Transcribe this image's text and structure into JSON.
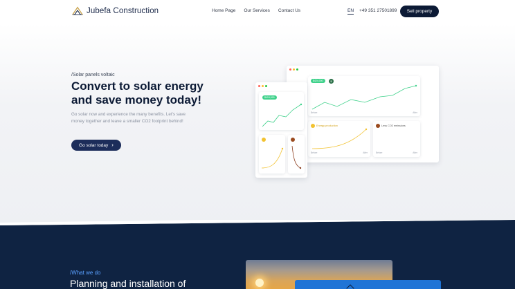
{
  "brand": {
    "name": "Jubefa Construction"
  },
  "nav": {
    "links": [
      "Home Page",
      "Our Services",
      "Contact Us"
    ],
    "language": "EN",
    "phone": "+49 351 27501899",
    "cta": "Sell property"
  },
  "hero": {
    "eyebrow": "/Solar panels voltaic",
    "headline": "Convert to solar energy and save money today!",
    "subtext": "Go solar now and experience the many benefits. Let's save money together and leave a smaller CO2 footprint behind!",
    "cta": "Go solar today"
  },
  "dashboard": {
    "savings_pill": "$424,000",
    "savings_pill_small": "$424,000",
    "energy_label": "Energy production",
    "co2_label": "Less CO2 emissions",
    "before_label": "Before",
    "after_label": "After"
  },
  "section": {
    "eyebrow": "/What we do",
    "title": "Planning and installation of"
  },
  "colors": {
    "navy": "#0c1a35",
    "cta_blue": "#1c2d5a",
    "green": "#3ed18a",
    "yellow": "#f2c230",
    "accent_blue": "#1f74d6"
  }
}
